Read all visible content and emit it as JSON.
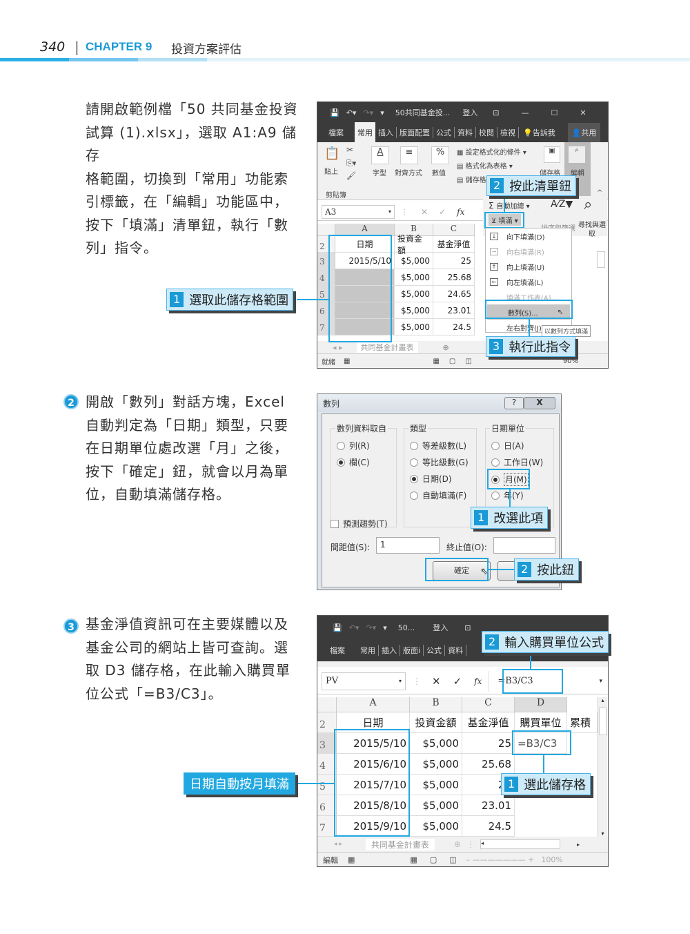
{
  "header": {
    "page_number": "340",
    "separator": "|",
    "chapter": "CHAPTER 9",
    "chapter_title": "投資方案評估",
    "accent_colors": [
      "#2bb0e6",
      "#73c6ee",
      "#b3e0f6",
      "#e3f3fb"
    ]
  },
  "step1": {
    "text_lines": [
      "請開啟範例檔「50 共同基金投資",
      "試算 (1).xlsx」，選取 A1:A9 儲存",
      "格範圍，切換到「常用」功能索",
      "引標籤，在「編輯」功能區中，",
      "按下「填滿」清單鈕，執行「數",
      "列」指令。"
    ],
    "callout_select": {
      "num": "1",
      "label": "選取此儲存格範圍"
    },
    "callout_fill": {
      "num": "2",
      "label": "按此清單鈕"
    },
    "callout_series": {
      "num": "3",
      "label": "執行此指令"
    },
    "excel": {
      "qat_title": "50共同基金投...",
      "signin": "登入",
      "tabs": [
        "檔案",
        "常用",
        "插入",
        "版面配置",
        "公式",
        "資料",
        "校閱",
        "檢視"
      ],
      "tell_me": "告訴我",
      "share": "共用",
      "ribbon": {
        "paste": "貼上",
        "clipboard": "剪貼簿",
        "font": "字型",
        "align": "對齊方式",
        "number": "數值",
        "cond_format": "設定格式化的條件",
        "format_table": "格式化為表格",
        "cell_style": "儲存格樣式",
        "cells": "儲存格",
        "editing": "編輯",
        "autosum": "自動加總",
        "fill": "填滿",
        "sort_filter": "排序與篩選",
        "find_select": "尋找與選取"
      },
      "name_box": "A3",
      "columns": [
        "A",
        "B",
        "C"
      ],
      "rows": [
        {
          "row": "2",
          "cells": [
            "日期",
            "投資金額",
            "基金淨值"
          ]
        },
        {
          "row": "3",
          "cells": [
            "2015/5/10",
            "$5,000",
            "25"
          ]
        },
        {
          "row": "4",
          "cells": [
            "",
            "$5,000",
            "25.68"
          ]
        },
        {
          "row": "5",
          "cells": [
            "",
            "$5,000",
            "24.65"
          ]
        },
        {
          "row": "6",
          "cells": [
            "",
            "$5,000",
            "23.01"
          ]
        },
        {
          "row": "7",
          "cells": [
            "",
            "$5,000",
            "24.5"
          ]
        }
      ],
      "fill_menu": [
        {
          "label": "向下填滿(D)",
          "icon": "arrow-down",
          "disabled": false
        },
        {
          "label": "向右填滿(R)",
          "icon": "arrow-right",
          "disabled": true
        },
        {
          "label": "向上填滿(U)",
          "icon": "arrow-up",
          "disabled": false
        },
        {
          "label": "向左填滿(L)",
          "icon": "arrow-left",
          "disabled": false
        },
        {
          "label": "填滿工作表(A)...",
          "icon": "",
          "disabled": true
        },
        {
          "label": "數列(S)...",
          "icon": "",
          "disabled": false,
          "highlighted": true
        },
        {
          "label": "左右對齊(J)",
          "icon": "",
          "disabled": false
        }
      ],
      "tooltip": "以數列方式填滿",
      "sheet_tab": "共同基金計畫表",
      "status": "就緒",
      "zoom": "90%"
    }
  },
  "step2": {
    "number": "2",
    "text_lines": [
      "開啟「數列」對話方塊，Excel",
      "自動判定為「日期」類型，只要",
      "在日期單位處改選「月」之後，",
      "按下「確定」鈕，就會以月為單",
      "位，自動填滿儲存格。"
    ],
    "dialog": {
      "title": "數列",
      "help": "?",
      "close": "X",
      "series_in": {
        "label": "數列資料取自",
        "options": [
          "列(R)",
          "欄(C)"
        ],
        "selected": 1
      },
      "type": {
        "label": "類型",
        "options": [
          "等差級數(L)",
          "等比級數(G)",
          "日期(D)",
          "自動填滿(F)"
        ],
        "selected": 2
      },
      "date_unit": {
        "label": "日期單位",
        "options": [
          "日(A)",
          "工作日(W)",
          "月(M)",
          "年(Y)"
        ],
        "selected": 2
      },
      "trend": "預測趨勢(T)",
      "step_label": "間距值(S):",
      "step_value": "1",
      "stop_label": "終止值(O):",
      "stop_value": "",
      "ok": "確定"
    },
    "callout_option": {
      "num": "1",
      "label": "改選此項"
    },
    "callout_button": {
      "num": "2",
      "label": "按此鈕"
    }
  },
  "step3": {
    "number": "3",
    "text_lines": [
      "基金淨值資訊可在主要媒體以及",
      "基金公司的網站上皆可查詢。選",
      "取 D3 儲存格，在此輸入購買單",
      "位公式「=B3/C3」。"
    ],
    "callout_formula": {
      "num": "2",
      "label": "輸入購買單位公式"
    },
    "callout_cell": {
      "num": "1",
      "label": "選此儲存格"
    },
    "callout_autofill": {
      "label": "日期自動按月填滿"
    },
    "excel": {
      "qat_title": "50...",
      "signin": "登入",
      "tabs": [
        "檔案",
        "常用",
        "插入",
        "版面i",
        "公式",
        "資料"
      ],
      "name_box": "PV",
      "formula": "=B3/C3",
      "columns": [
        "A",
        "B",
        "C",
        "D"
      ],
      "rows": [
        {
          "row": "2",
          "cells": [
            "日期",
            "投資金額",
            "基金淨值",
            "購買單位",
            "累積"
          ]
        },
        {
          "row": "3",
          "cells": [
            "2015/5/10",
            "$5,000",
            "25",
            "=B3/C3",
            ""
          ]
        },
        {
          "row": "4",
          "cells": [
            "2015/6/10",
            "$5,000",
            "25.68",
            "",
            ""
          ]
        },
        {
          "row": "5",
          "cells": [
            "2015/7/10",
            "$5,000",
            "24",
            "",
            ""
          ]
        },
        {
          "row": "6",
          "cells": [
            "2015/8/10",
            "$5,000",
            "23.01",
            "",
            ""
          ]
        },
        {
          "row": "7",
          "cells": [
            "2015/9/10",
            "$5,000",
            "24.5",
            "",
            ""
          ]
        }
      ],
      "sheet_tab": "共同基金計畫表",
      "status": "編輯",
      "zoom": "100%"
    }
  }
}
